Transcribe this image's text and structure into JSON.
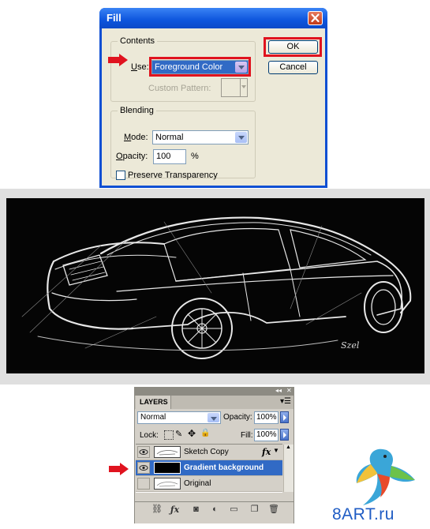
{
  "fill_dialog": {
    "title": "Fill",
    "contents_group": "Contents",
    "use_label": "Use:",
    "use_value": "Foreground Color",
    "custom_pattern_label": "Custom Pattern:",
    "blending_group": "Blending",
    "mode_label": "Mode:",
    "mode_value": "Normal",
    "opacity_label": "Opacity:",
    "opacity_value": "100",
    "opacity_unit": "%",
    "preserve_transparency_label": "Preserve Transparency",
    "preserve_transparency_checked": false,
    "ok_label": "OK",
    "cancel_label": "Cancel"
  },
  "sketch": {
    "signature": "Szel"
  },
  "layers_panel": {
    "tab_label": "LAYERS",
    "blend_mode": "Normal",
    "opacity_label": "Opacity:",
    "opacity_value": "100%",
    "lock_label": "Lock:",
    "fill_label": "Fill:",
    "fill_value": "100%",
    "fx_label": "fx",
    "layers": [
      {
        "name": "Sketch Copy",
        "visible": true,
        "selected": false,
        "has_fx": true
      },
      {
        "name": "Gradient background",
        "visible": true,
        "selected": true,
        "has_fx": false
      },
      {
        "name": "Original",
        "visible": false,
        "selected": false,
        "has_fx": false
      }
    ],
    "footer_icons": [
      "link-icon",
      "fx-icon",
      "mask-icon",
      "adjustment-icon",
      "group-icon",
      "new-layer-icon",
      "trash-icon"
    ]
  },
  "watermark": {
    "text": "8ART.ru"
  },
  "colors": {
    "highlight_red": "#e0131f",
    "xp_blue": "#0d55dd",
    "selected_layer": "#316ac5",
    "dialog_bg": "#ece9d8"
  }
}
